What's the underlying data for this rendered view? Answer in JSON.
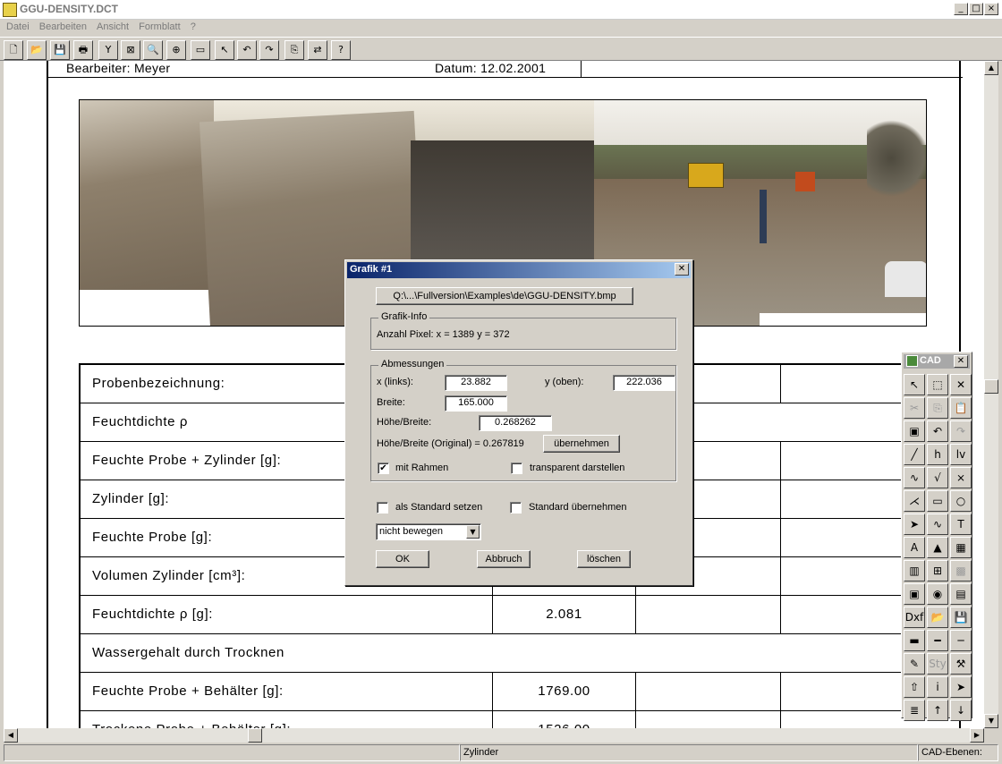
{
  "window": {
    "title": "GGU-DENSITY.DCT",
    "controls": [
      "_",
      "□",
      "×"
    ]
  },
  "menu": [
    "Datei",
    "Bearbeiten",
    "Ansicht",
    "Formblatt",
    "?"
  ],
  "toolbar_icons": [
    "new-file",
    "open-folder",
    "save",
    "print",
    "wrench",
    "zoom-page",
    "zoom-out",
    "zoom-in",
    "full-screen",
    "pointer",
    "undo",
    "redo",
    "copy-to-clipboard",
    "export",
    "help"
  ],
  "toolbar_glyphs": [
    "🗋",
    "📂",
    "💾",
    "🖶",
    "Y",
    "⊠",
    "🔍",
    "⊕",
    "▭",
    "↖",
    "↶",
    "↷",
    "⎘",
    "⇄",
    "?"
  ],
  "header": {
    "bearbeiter": "Bearbeiter:  Meyer",
    "datum": "Datum:  12.02.2001"
  },
  "table": {
    "rows": [
      {
        "label": "Probenbezeichnung:",
        "value": ""
      },
      {
        "label": "Feuchtdichte ρ",
        "value": ""
      },
      {
        "label": "Feuchte Probe + Zylinder [g]:",
        "value": ""
      },
      {
        "label": "Zylinder [g]:",
        "value": ""
      },
      {
        "label": "Feuchte Probe [g]:",
        "value": ""
      },
      {
        "label": "Volumen Zylinder [cm³]:",
        "value": ""
      },
      {
        "label": "Feuchtdichte ρ [g]:",
        "value": "2.081"
      },
      {
        "label": "Wassergehalt durch Trocknen",
        "value": ""
      },
      {
        "label": "Feuchte Probe + Behälter [g]:",
        "value": "1769.00"
      },
      {
        "label": "Trockene Probe + Behälter [g]:",
        "value": "1526.00"
      }
    ]
  },
  "dialog": {
    "title": "Grafik  #1",
    "file_button": "Q:\\...\\Fullversion\\Examples\\de\\GGU-DENSITY.bmp",
    "info_group": "Grafik-Info",
    "info_text": "Anzahl Pixel: x = 1389  y = 372",
    "dim_group": "Abmessungen",
    "x_label": "x (links):",
    "x_value": "23.882",
    "y_label": "y (oben):",
    "y_value": "222.036",
    "breite_label": "Breite:",
    "breite_value": "165.000",
    "hb_label": "Höhe/Breite:",
    "hb_value": "0.268262",
    "hb_original": "Höhe/Breite (Original) = 0.267819",
    "uebernehmen": "übernehmen",
    "mit_rahmen": "mit Rahmen",
    "mit_rahmen_checked": "✔",
    "transparent": "transparent darstellen",
    "standard_setzen": "als Standard setzen",
    "standard_uebernehmen": "Standard übernehmen",
    "move_select": "nicht bewegen",
    "ok": "OK",
    "abbruch": "Abbruch",
    "loeschen": "löschen"
  },
  "cad": {
    "title": "CAD",
    "buttons": [
      "↖",
      "⬚",
      "✕",
      "✂",
      "⎘",
      "📋",
      "▣",
      "↶",
      "↷",
      "╱",
      "h",
      "lv",
      "∿",
      "√",
      "⨯",
      "⋌",
      "▭",
      "○",
      "➤",
      "∿",
      "T",
      "A",
      "▲",
      "▦",
      "▥",
      "⊞",
      "▩",
      "▣",
      "◉",
      "▤",
      "Dxf",
      "📂",
      "💾",
      "▬",
      "━",
      "─",
      "✎",
      "Sty",
      "⚒",
      "⇧",
      "i",
      "➤",
      "≣",
      "↑",
      "↓"
    ]
  },
  "status": {
    "center": "Zylinder",
    "right": "CAD-Ebenen:"
  }
}
